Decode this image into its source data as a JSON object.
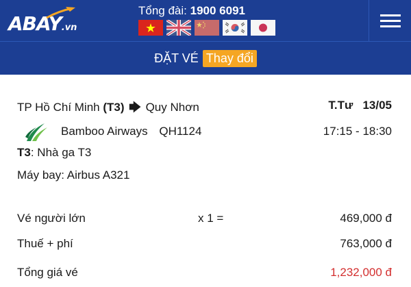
{
  "header": {
    "logo": {
      "main": "BAY",
      "suffix": ".vn"
    },
    "hotline_label": "Tổng đài:",
    "hotline_number": "1900 6091",
    "flags": [
      "vietnam-flag",
      "uk-flag",
      "china-flag",
      "korea-flag",
      "japan-flag"
    ],
    "menu_icon": "hamburger-menu-icon"
  },
  "booking_bar": {
    "title": "ĐẶT VÉ",
    "change_label": "Thay đổi"
  },
  "flight": {
    "origin": "TP Hồ Chí Minh",
    "terminal_code": "(T3)",
    "destination": "Quy Nhơn",
    "weekday": "T.Tư",
    "date": "13/05",
    "airline": "Bamboo Airways",
    "flight_number": "QH1124",
    "time": "17:15 - 18:30",
    "terminal_label": "T3",
    "terminal_text": ": Nhà ga T3",
    "aircraft": "Máy bay: Airbus A321"
  },
  "pricing": {
    "adult_label": "Vé người lớn",
    "adult_qty": "x 1 =",
    "adult_amount": "469,000 đ",
    "tax_label": "Thuế + phí",
    "tax_amount": "763,000 đ",
    "total_label": "Tổng giá vé",
    "total_amount": "1,232,000 đ"
  },
  "colors": {
    "header_bg": "#1c3e93",
    "accent_orange": "#f5a623",
    "total_red": "#d32f2f"
  }
}
